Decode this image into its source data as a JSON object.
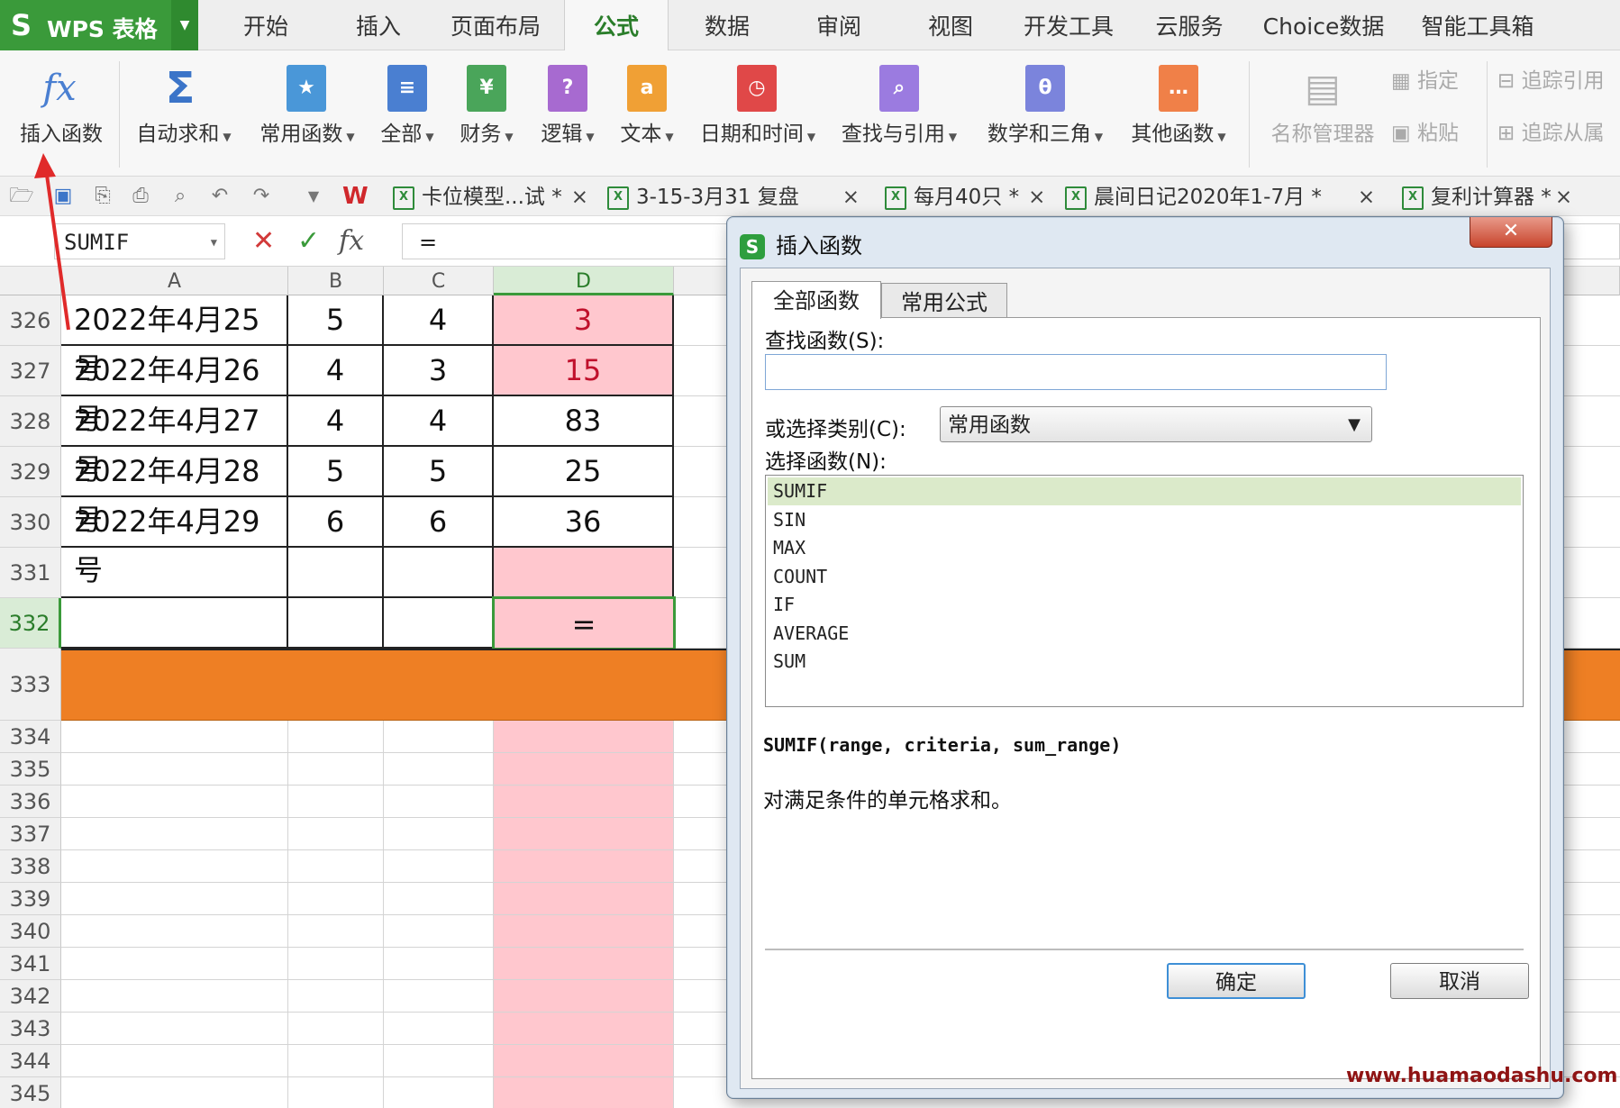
{
  "app": {
    "name": "WPS 表格",
    "logo": "S"
  },
  "menu_tabs": [
    "开始",
    "插入",
    "页面布局",
    "公式",
    "数据",
    "审阅",
    "视图",
    "开发工具",
    "云服务",
    "Choice数据",
    "智能工具箱"
  ],
  "active_menu_tab": "公式",
  "ribbon": {
    "insert_function": "插入函数",
    "autosum": "自动求和",
    "common_functions": "常用函数",
    "all": "全部",
    "financial": "财务",
    "logical": "逻辑",
    "text": "文本",
    "datetime": "日期和时间",
    "lookup": "查找与引用",
    "math": "数学和三角",
    "other": "其他函数",
    "name_manager": "名称管理器",
    "specify": "指定",
    "paste": "粘贴",
    "trace_precedents": "追踪引用",
    "trace_dependents": "追踪从属",
    "colors": {
      "all": "#4a7fd1",
      "financial": "#4aa55a",
      "logical": "#a76ad0",
      "text": "#f0a035",
      "datetime": "#e04848",
      "lookup": "#9b7be0",
      "math": "#7b84dc",
      "other": "#f08048",
      "common": "#4a97d8"
    }
  },
  "doc_tabs": [
    {
      "title": "卡位模型...试 *",
      "close": "×"
    },
    {
      "title": "3-15-3月31 复盘",
      "close": "×"
    },
    {
      "title": "每月40只 *",
      "close": "×"
    },
    {
      "title": "晨间日记2020年1-7月 *",
      "close": "×"
    },
    {
      "title": "复利计算器 *",
      "close": "×"
    }
  ],
  "formula_bar": {
    "name_box": "SUMIF",
    "cancel": "✕",
    "confirm": "✓",
    "fx": "fx",
    "formula": "="
  },
  "sheet": {
    "columns": [
      "A",
      "B",
      "C",
      "D"
    ],
    "rows": [
      {
        "num": "326",
        "a": "2022年4月25号",
        "b": "5",
        "c": "4",
        "d": "3"
      },
      {
        "num": "327",
        "a": "2022年4月26号",
        "b": "4",
        "c": "3",
        "d": "15"
      },
      {
        "num": "328",
        "a": "2022年4月27号",
        "b": "4",
        "c": "4",
        "d": "83"
      },
      {
        "num": "329",
        "a": "2022年4月28号",
        "b": "5",
        "c": "5",
        "d": "25"
      },
      {
        "num": "330",
        "a": "2022年4月29号",
        "b": "6",
        "c": "6",
        "d": "36"
      },
      {
        "num": "331",
        "a": "",
        "b": "",
        "c": "",
        "d": ""
      },
      {
        "num": "332",
        "a": "",
        "b": "",
        "c": "",
        "d": "="
      },
      {
        "num": "333",
        "a": "",
        "b": "",
        "c": "",
        "d": ""
      }
    ],
    "empty_rows": [
      "334",
      "335",
      "336",
      "337",
      "338",
      "339",
      "340",
      "341",
      "342",
      "343",
      "344",
      "345"
    ]
  },
  "dialog": {
    "title": "插入函数",
    "close": "✕",
    "tabs": [
      "全部函数",
      "常用公式"
    ],
    "active_tab": "全部函数",
    "search_label": "查找函数(S):",
    "search_value": "",
    "category_label": "或选择类别(C):",
    "category_value": "常用函数",
    "select_label": "选择函数(N):",
    "functions": [
      "SUMIF",
      "SIN",
      "MAX",
      "COUNT",
      "IF",
      "AVERAGE",
      "SUM"
    ],
    "selected_function": "SUMIF",
    "signature": "SUMIF(range, criteria, sum_range)",
    "description": "对满足条件的单元格求和。",
    "ok": "确定",
    "cancel": "取消"
  },
  "watermark": "www.huamaodashu.com"
}
